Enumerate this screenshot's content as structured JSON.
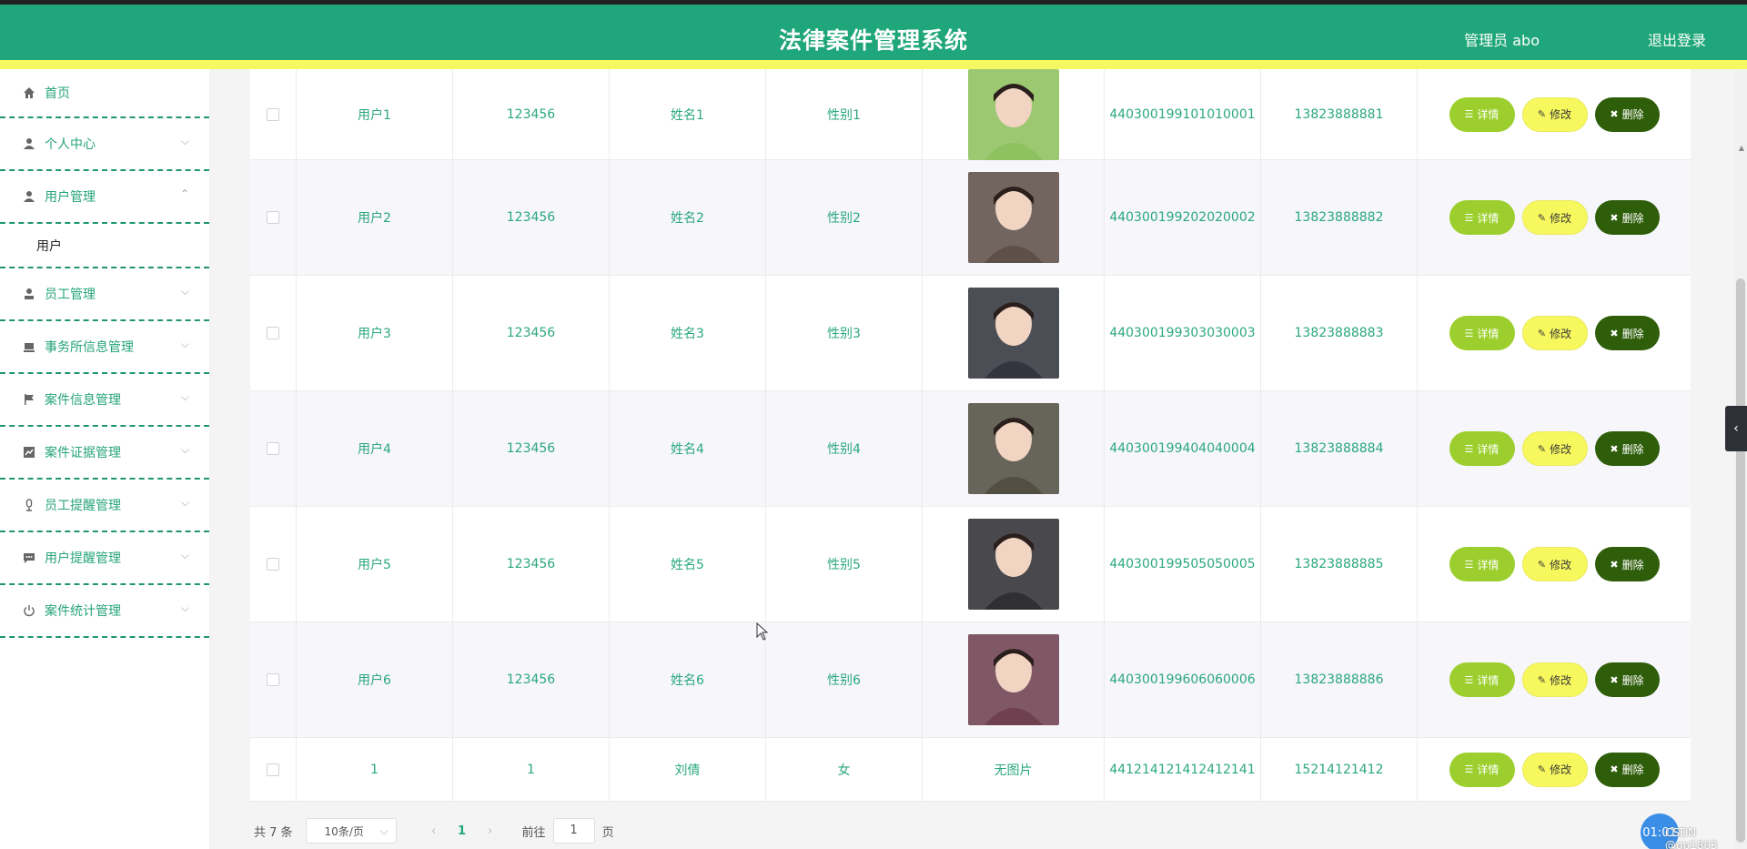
{
  "header": {
    "title": "法律案件管理系统",
    "admin": "管理员 abo",
    "logout": "退出登录"
  },
  "sidebar": {
    "items": [
      {
        "label": "首页",
        "icon": "home-icon"
      },
      {
        "label": "个人中心",
        "icon": "user-icon"
      },
      {
        "label": "用户管理",
        "icon": "user-icon",
        "expanded": true,
        "children": [
          "用户"
        ]
      },
      {
        "label": "员工管理",
        "icon": "staff-icon"
      },
      {
        "label": "事务所信息管理",
        "icon": "laptop-icon"
      },
      {
        "label": "案件信息管理",
        "icon": "flag-icon"
      },
      {
        "label": "案件证据管理",
        "icon": "chart-icon"
      },
      {
        "label": "员工提醒管理",
        "icon": "mic-icon"
      },
      {
        "label": "用户提醒管理",
        "icon": "message-icon"
      },
      {
        "label": "案件统计管理",
        "icon": "power-icon"
      }
    ]
  },
  "table": {
    "rows": [
      {
        "user": "用户1",
        "password": "123456",
        "name": "姓名1",
        "sex": "性别1",
        "id": "440300199101010001",
        "phone": "13823888881",
        "has_image": true,
        "avatar_color": "#8bbf5a"
      },
      {
        "user": "用户2",
        "password": "123456",
        "name": "姓名2",
        "sex": "性别2",
        "id": "440300199202020002",
        "phone": "13823888882",
        "has_image": true,
        "avatar_color": "#5a4a44"
      },
      {
        "user": "用户3",
        "password": "123456",
        "name": "姓名3",
        "sex": "性别3",
        "id": "440300199303030003",
        "phone": "13823888883",
        "has_image": true,
        "avatar_color": "#2c3038"
      },
      {
        "user": "用户4",
        "password": "123456",
        "name": "姓名4",
        "sex": "性别4",
        "id": "440300199404040004",
        "phone": "13823888884",
        "has_image": true,
        "avatar_color": "#4d4a3c"
      },
      {
        "user": "用户5",
        "password": "123456",
        "name": "姓名5",
        "sex": "性别5",
        "id": "440300199505050005",
        "phone": "13823888885",
        "has_image": true,
        "avatar_color": "#2a2a2e"
      },
      {
        "user": "用户6",
        "password": "123456",
        "name": "姓名6",
        "sex": "性别6",
        "id": "440300199606060006",
        "phone": "13823888886",
        "has_image": true,
        "avatar_color": "#6a3b4a"
      },
      {
        "user": "1",
        "password": "1",
        "name": "刘倩",
        "sex": "女",
        "id": "441214121412412141",
        "phone": "15214121412",
        "has_image": false,
        "no_image_text": "无图片"
      }
    ],
    "buttons": {
      "detail": "详情",
      "edit": "修改",
      "delete": "删除"
    }
  },
  "pagination": {
    "total": "共 7 条",
    "page_size": "10条/页",
    "current_page": "1",
    "goto_label": "前往",
    "goto_value": "1",
    "page_suffix": "页"
  },
  "overlay": {
    "timer": "01:01",
    "watermark": "CSDN @gp1803"
  },
  "colors": {
    "primary": "#1fa67a",
    "accent_yellow": "#f6f861",
    "detail_button": "#9ccf2d",
    "delete_button": "#2f5e0b"
  }
}
